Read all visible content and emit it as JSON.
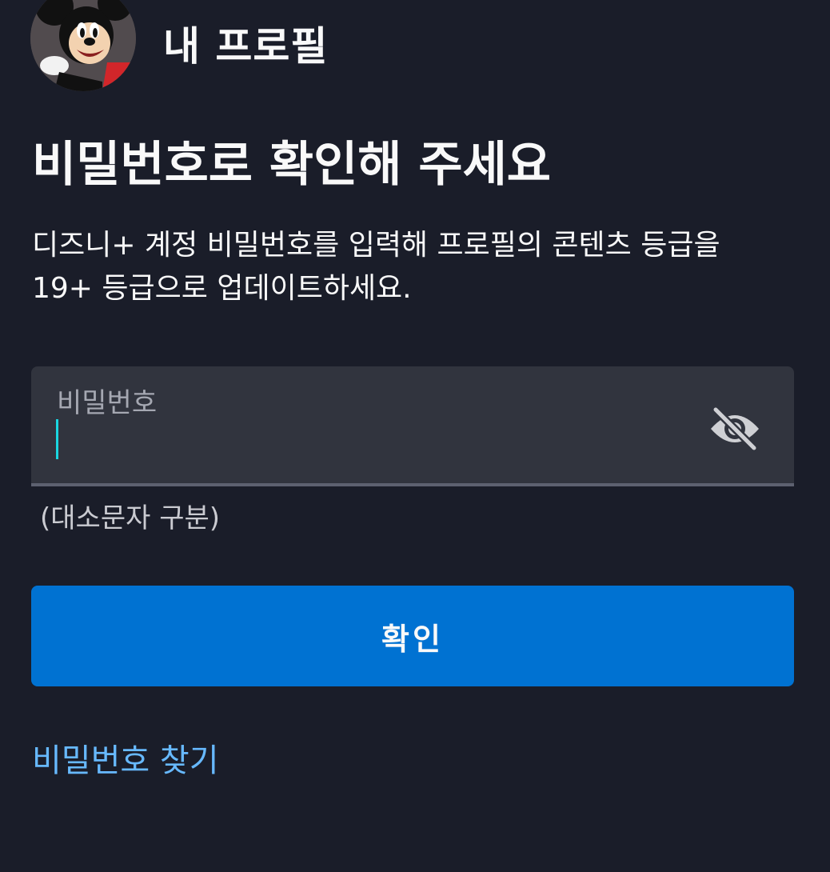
{
  "header": {
    "avatar_icon": "mickey-mouse-avatar",
    "profile_title": "내 프로필"
  },
  "main": {
    "title": "비밀번호로 확인해 주세요",
    "description": "디즈니+ 계정 비밀번호를 입력해 프로필의 콘텐츠 등급을 19+ 등급으로 업데이트하세요."
  },
  "password_field": {
    "label": "비밀번호",
    "value": "",
    "visibility_icon": "eye-slash-icon",
    "hint": "(대소문자 구분)"
  },
  "actions": {
    "confirm_label": "확인",
    "forgot_password_label": "비밀번호 찾기"
  },
  "colors": {
    "background": "#1a1d29",
    "field_background": "#31343e",
    "primary_button": "#0072d2",
    "link": "#67b9ff",
    "caret": "#1ad6e0"
  }
}
